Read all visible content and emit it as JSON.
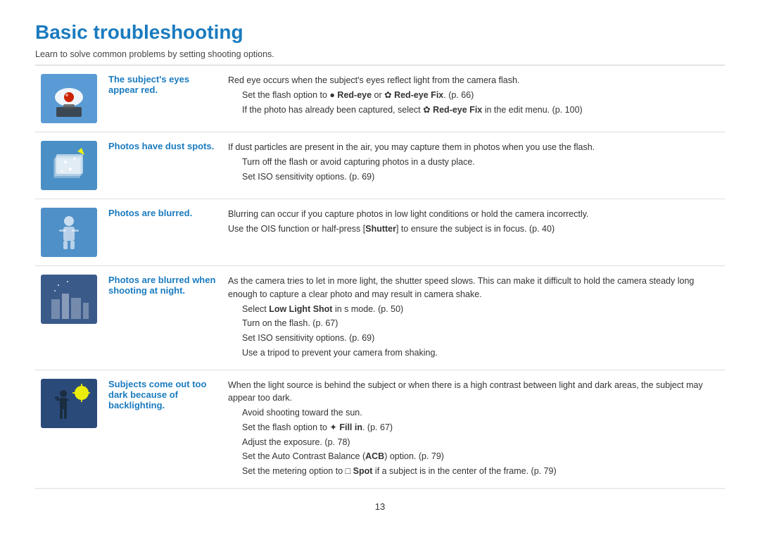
{
  "page": {
    "title": "Basic troubleshooting",
    "subtitle": "Learn to solve common problems by setting shooting options.",
    "page_number": "13"
  },
  "rows": [
    {
      "id": "red-eye",
      "label": "The subject's eyes appear red.",
      "description_lines": [
        {
          "text": "Red eye occurs when the subject's eyes reflect light from the camera flash.",
          "indent": false
        },
        {
          "text": "Set the flash option to ● Red-eye or ✿ Red-eye Fix. (p. 66)",
          "indent": true
        },
        {
          "text": "If the photo has already been captured, select ✿ Red-eye Fix in the edit menu. (p. 100)",
          "indent": true
        }
      ]
    },
    {
      "id": "dust-spots",
      "label": "Photos have dust spots.",
      "description_lines": [
        {
          "text": "If dust particles are present in the air, you may capture them in photos when you use the flash.",
          "indent": false
        },
        {
          "text": "Turn off the flash or avoid capturing photos in a dusty place.",
          "indent": true
        },
        {
          "text": "Set ISO sensitivity options. (p. 69)",
          "indent": true
        }
      ]
    },
    {
      "id": "blurred",
      "label": "Photos are blurred.",
      "description_lines": [
        {
          "text": "Blurring can occur if you capture photos in low light conditions or hold the camera incorrectly.",
          "indent": false
        },
        {
          "text": "Use the OIS function or half-press [Shutter] to ensure the subject is in focus. (p. 40)",
          "indent": false
        }
      ]
    },
    {
      "id": "blurred-night",
      "label": "Photos are blurred when shooting at night.",
      "description_lines": [
        {
          "text": "As the camera tries to let in more light, the shutter speed slows. This can make it difficult to hold the camera steady long enough to capture a clear photo and may result in camera shake.",
          "indent": false
        },
        {
          "text": "Select Low Light Shot in s    mode. (p. 50)",
          "indent": true
        },
        {
          "text": "Turn on the flash. (p. 67)",
          "indent": true
        },
        {
          "text": "Set ISO sensitivity options. (p. 69)",
          "indent": true
        },
        {
          "text": "Use a tripod to prevent your camera from shaking.",
          "indent": true
        }
      ]
    },
    {
      "id": "backlight",
      "label": "Subjects come out too dark because of backlighting.",
      "description_lines": [
        {
          "text": "When the light source is behind the subject or when there is a high contrast between light and dark areas, the subject may appear too dark.",
          "indent": false
        },
        {
          "text": "Avoid shooting toward the sun.",
          "indent": true
        },
        {
          "text": "Set the flash option to ✦ Fill in. (p. 67)",
          "indent": true
        },
        {
          "text": "Adjust the exposure. (p. 78)",
          "indent": true
        },
        {
          "text": "Set the Auto Contrast Balance (ACB) option. (p. 79)",
          "indent": true
        },
        {
          "text": "Set the metering option to □ Spot if a subject is in the center of the frame. (p. 79)",
          "indent": true
        }
      ]
    }
  ]
}
